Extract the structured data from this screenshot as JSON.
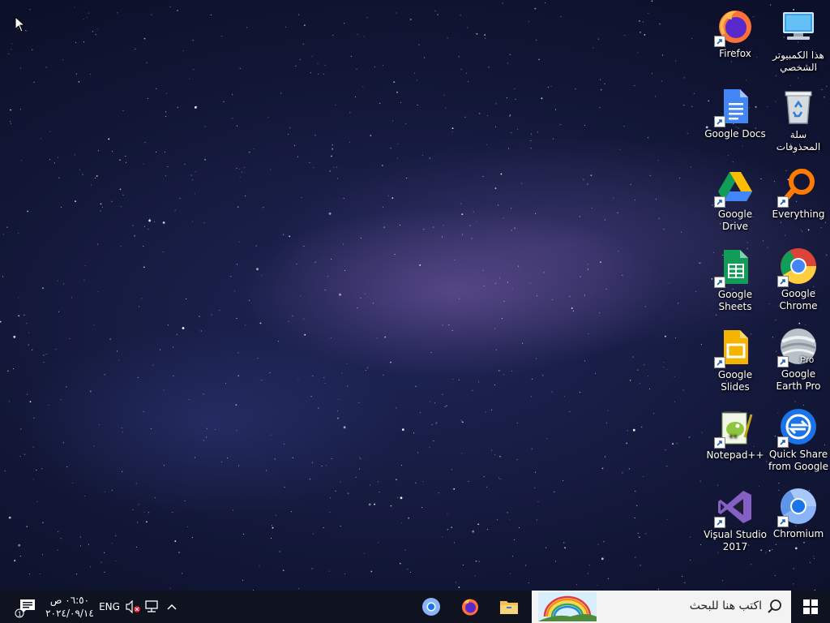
{
  "desktop": {
    "icons": [
      {
        "label": "هذا الكمبيوتر الشخصي",
        "icon": "this-pc-icon"
      },
      {
        "label": "Firefox",
        "icon": "firefox-icon"
      },
      {
        "label": "سلة المحذوفات",
        "icon": "recycle-bin-icon"
      },
      {
        "label": "Google Docs",
        "icon": "google-docs-icon"
      },
      {
        "label": "Everything",
        "icon": "everything-icon"
      },
      {
        "label": "Google Drive",
        "icon": "google-drive-icon"
      },
      {
        "label": "Google Chrome",
        "icon": "chrome-icon"
      },
      {
        "label": "Google Sheets",
        "icon": "google-sheets-icon"
      },
      {
        "label": "Google Earth Pro",
        "icon": "google-earth-pro-icon"
      },
      {
        "label": "Google Slides",
        "icon": "google-slides-icon"
      },
      {
        "label": "Quick Share from Google",
        "icon": "quick-share-icon"
      },
      {
        "label": "Notepad++",
        "icon": "notepad-plus-plus-icon"
      },
      {
        "label": "Chromium",
        "icon": "chromium-icon"
      },
      {
        "label": "Visual Studio 2017",
        "icon": "visual-studio-icon"
      }
    ],
    "earth_badge": "Pro"
  },
  "taskbar": {
    "search_placeholder": "اكتب هنا للبحث",
    "pinned": [
      {
        "name": "file-explorer",
        "icon": "folder-icon"
      },
      {
        "name": "firefox",
        "icon": "firefox-icon"
      },
      {
        "name": "chromium",
        "icon": "chromium-icon"
      }
    ],
    "tray": {
      "language": "ENG",
      "time": "٠٦:٥٠ ص",
      "date": "٢٠٢٤/٠٩/١٤",
      "notification_count": "1"
    }
  },
  "colors": {
    "taskbar": "#0f1320",
    "search_box": "#f3f3f3",
    "firefox_orange": "#ff7139",
    "chrome_blue": "#4285f4"
  }
}
